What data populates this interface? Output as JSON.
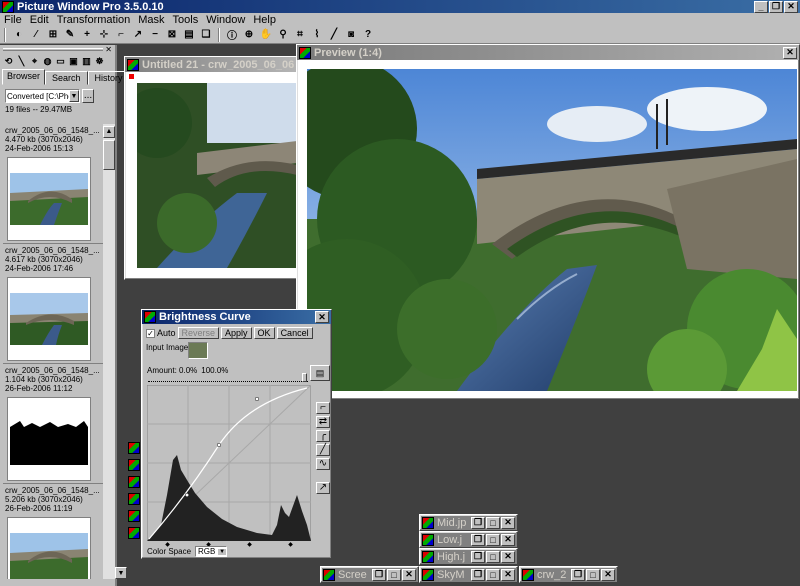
{
  "app": {
    "title": "Picture Window Pro 3.5.0.10"
  },
  "menu": [
    "File",
    "Edit",
    "Transformation",
    "Mask",
    "Tools",
    "Window",
    "Help"
  ],
  "window_buttons": {
    "minimize": "_",
    "restore": "❐",
    "close": "✕"
  },
  "browser": {
    "tabs": [
      "Browser",
      "Search",
      "History"
    ],
    "folder": "Converted [C:\\Photo",
    "folder_button": "...",
    "summary": "19 files -- 29.47MB",
    "files": [
      {
        "name": "crw_2005_06_06_1548_...",
        "info": "4.470 kb (3070x2046)",
        "date": "24-Feb-2006 15:13"
      },
      {
        "name": "crw_2005_06_06_1548_...",
        "info": "4.617 kb (3070x2046)",
        "date": "24-Feb-2006 17:46"
      },
      {
        "name": "crw_2005_06_06_1548_...",
        "info": "1.104 kb (3070x2046)",
        "date": "26-Feb-2006 11:12"
      },
      {
        "name": "crw_2005_06_06_1548_...",
        "info": "5.206 kb (3070x2046)",
        "date": "26-Feb-2006 11:19"
      }
    ]
  },
  "untitled": {
    "title": "Untitled 21 - crw_2005_06_06"
  },
  "preview": {
    "title": "Preview (1:4)"
  },
  "curve": {
    "title": "Brightness Curve",
    "auto_label": "Auto",
    "buttons": [
      "Reverse",
      "Apply",
      "OK",
      "Cancel"
    ],
    "input_label": "Input Image",
    "amount_label": "Amount: 0.0%",
    "amount_value": "100.0%",
    "colorspace_label": "Color Space",
    "colorspace_value": "RGB"
  },
  "minimized": [
    {
      "title": "Mid.jp"
    },
    {
      "title": "Low.j"
    },
    {
      "title": "High.j"
    },
    {
      "title": "Scree"
    },
    {
      "title": "SkyM"
    },
    {
      "title": "crw_2"
    }
  ],
  "toolbar_icons": [
    "split-view-icon",
    "wand-icon",
    "grid-icon",
    "pencil-icon",
    "plus-icon",
    "move-icon",
    "crop-icon",
    "arrow-icon",
    "minus-icon",
    "fit-icon",
    "stack-icon",
    "copy-icon",
    "info-icon",
    "compass-icon",
    "hand-icon",
    "zoom-icon",
    "eyedropper-icon",
    "brush-icon",
    "pen-icon",
    "camera-icon",
    "help-icon"
  ]
}
